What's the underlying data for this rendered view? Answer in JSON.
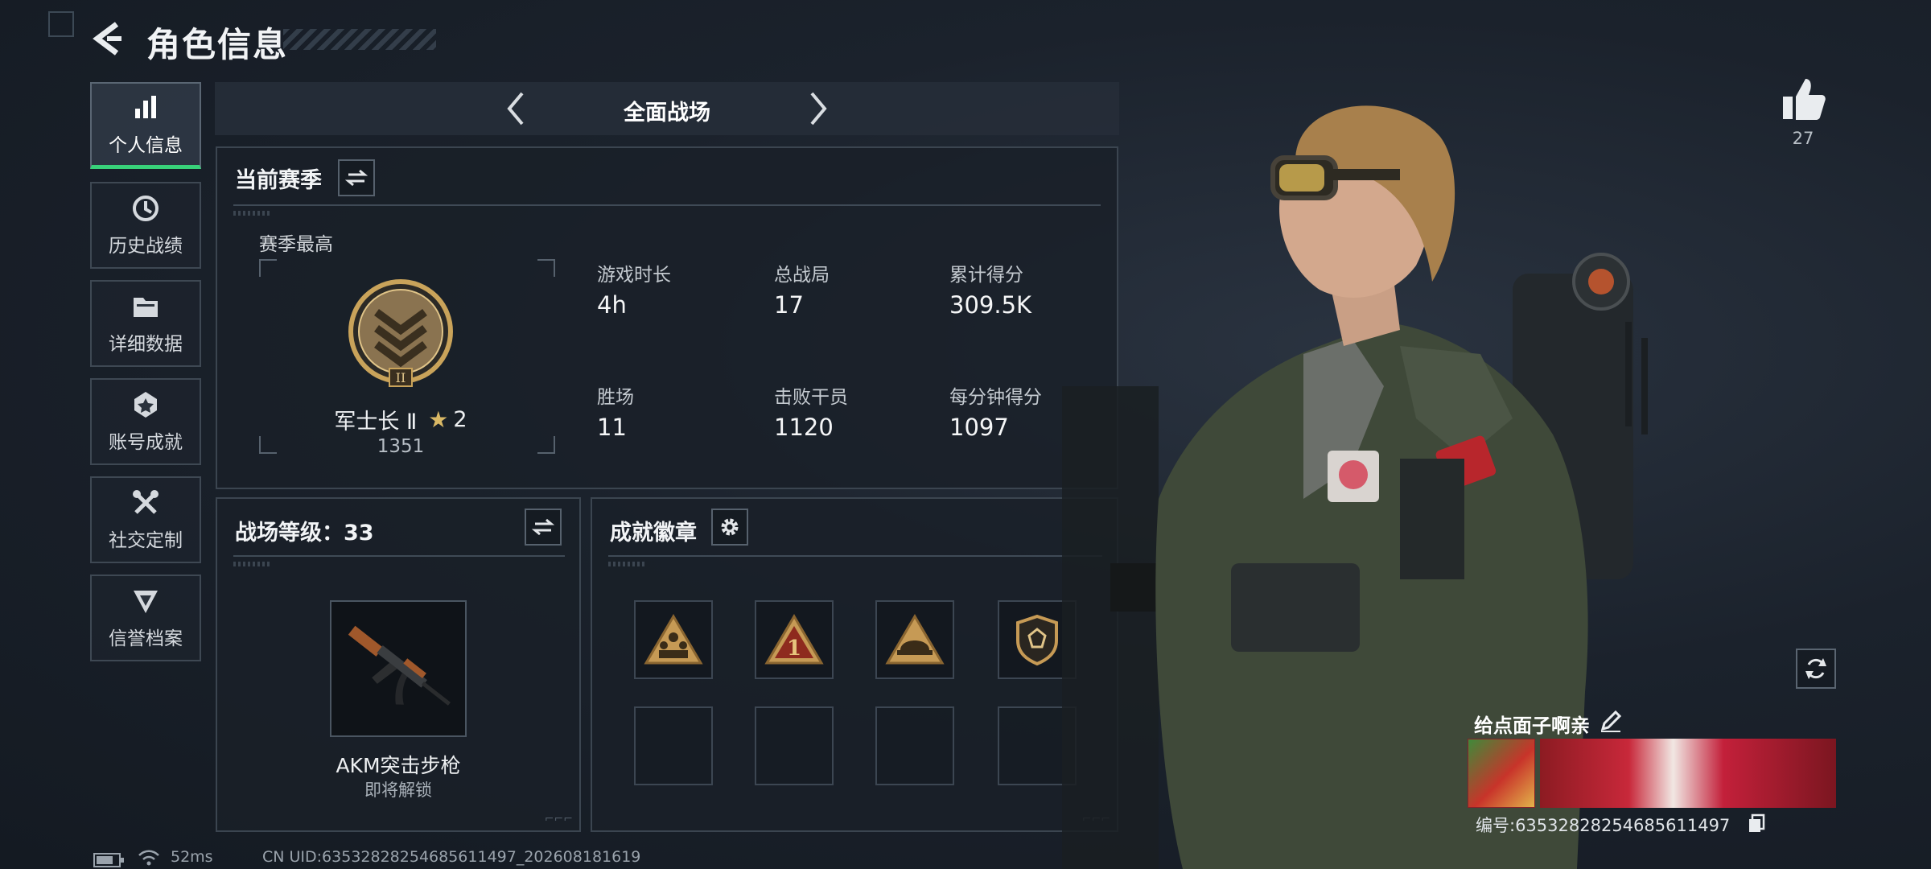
{
  "header": {
    "title": "角色信息"
  },
  "sidebar": {
    "items": [
      {
        "label": "个人信息",
        "icon": "bar-chart-icon",
        "active": true
      },
      {
        "label": "历史战绩",
        "icon": "history-clock-icon",
        "active": false
      },
      {
        "label": "详细数据",
        "icon": "folder-icon",
        "active": false
      },
      {
        "label": "账号成就",
        "icon": "achievement-icon",
        "active": false
      },
      {
        "label": "社交定制",
        "icon": "tools-icon",
        "active": false
      },
      {
        "label": "信誉档案",
        "icon": "reputation-icon",
        "active": false
      }
    ]
  },
  "mode": {
    "title": "全面战场"
  },
  "season": {
    "title": "当前赛季",
    "best_label": "赛季最高",
    "rank_name": "军士长 Ⅱ",
    "rank_stars": "2",
    "rank_points": "1351",
    "stats": [
      {
        "label": "游戏时长",
        "value": "4h"
      },
      {
        "label": "总战局",
        "value": "17"
      },
      {
        "label": "累计得分",
        "value": "309.5K"
      },
      {
        "label": "胜场",
        "value": "11"
      },
      {
        "label": "击败干员",
        "value": "1120"
      },
      {
        "label": "每分钟得分",
        "value": "1097"
      }
    ]
  },
  "level": {
    "title": "战场等级：33",
    "weapon_name": "AKM突击步枪",
    "weapon_status": "即将解锁"
  },
  "badges": {
    "title": "成就徽章",
    "slots": [
      "squad-badge-icon",
      "rank-one-badge-icon",
      "helmet-badge-icon",
      "shield-badge-icon",
      "",
      "",
      "",
      ""
    ]
  },
  "profile": {
    "likes": "27",
    "nickname": "给点面子啊亲",
    "uid_label": "编号:63532828254685611497"
  },
  "status_bar": {
    "ping": "52ms",
    "cn_uid": "CN UID:63532828254685611497_202608181619"
  },
  "colors": {
    "accent": "#38d27a",
    "gold": "#c9a35a",
    "panel_border": "#3b4550"
  }
}
